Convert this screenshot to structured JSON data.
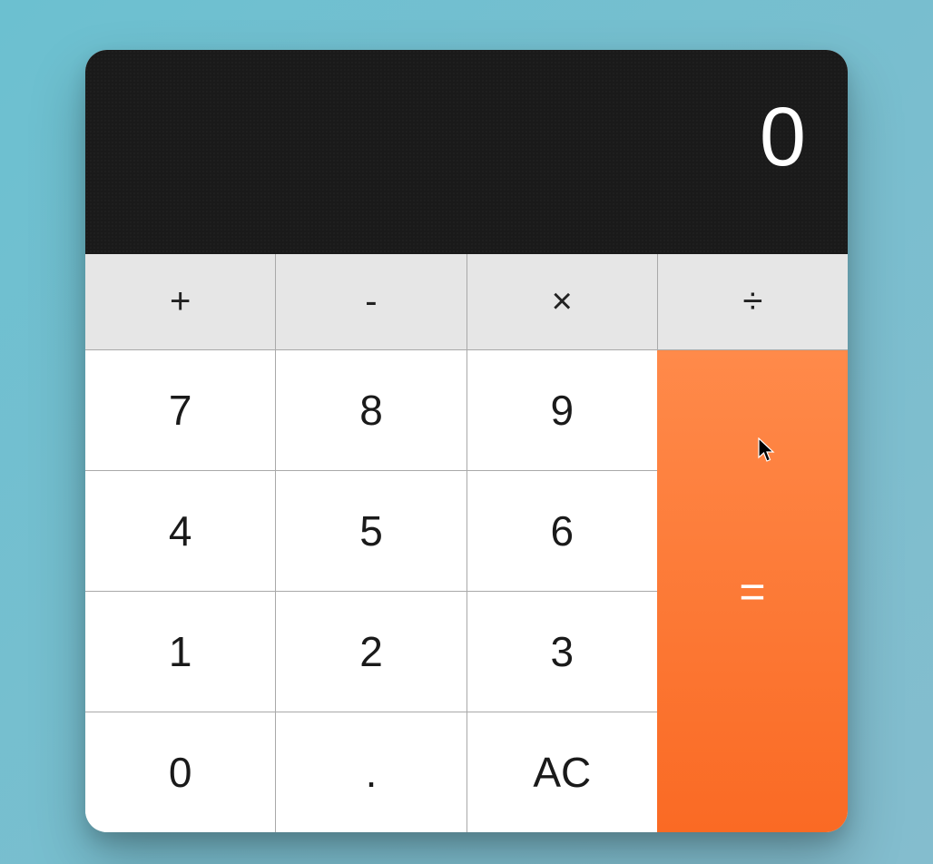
{
  "display": {
    "value": "0"
  },
  "operators": {
    "add": "+",
    "subtract": "-",
    "multiply": "×",
    "divide": "÷"
  },
  "digits": {
    "d7": "7",
    "d8": "8",
    "d9": "9",
    "d4": "4",
    "d5": "5",
    "d6": "6",
    "d1": "1",
    "d2": "2",
    "d3": "3",
    "d0": "0"
  },
  "decimal": ".",
  "clear": "AC",
  "equals": "=",
  "colors": {
    "background_start": "#6cc0d0",
    "background_end": "#84bdce",
    "display_bg": "#1a1a1a",
    "operator_bg": "#e6e6e6",
    "digit_bg": "#ffffff",
    "equals_start": "#ff8a4a",
    "equals_end": "#fa6a24",
    "border": "#a9a9a9"
  }
}
